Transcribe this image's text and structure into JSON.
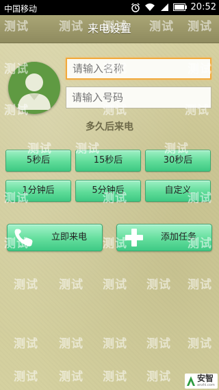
{
  "status_bar": {
    "carrier": "中国移动",
    "time": "20:52"
  },
  "title": "来电设置",
  "form": {
    "name_placeholder": "请输入名称",
    "phone_placeholder": "请输入号码"
  },
  "delay_section_title": "多久后来电",
  "delay_options": [
    "5秒后",
    "15秒后",
    "30秒后",
    "1分钟后",
    "5分钟后",
    "自定义"
  ],
  "actions": {
    "call_now": "立即来电",
    "add_task": "添加任务"
  },
  "watermark_text": "测试",
  "brand": {
    "name": "安智",
    "url": "anzhi.com"
  },
  "colors": {
    "accent_green": "#5fdc99",
    "title_bar": "#9c9869",
    "focus_orange": "#f2a93b"
  }
}
